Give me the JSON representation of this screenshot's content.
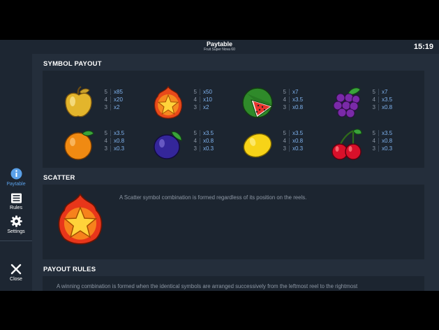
{
  "header": {
    "title": "Paytable",
    "subtitle": "Fruit Super Nova 60",
    "clock": "15:19"
  },
  "sidebar": {
    "items": [
      {
        "label": "Paytable",
        "icon": "info-icon",
        "active": true
      },
      {
        "label": "Rules",
        "icon": "rules-list-icon",
        "active": false
      },
      {
        "label": "Settings",
        "icon": "gear-icon",
        "active": false
      }
    ],
    "close_label": "Close"
  },
  "symbol_payout": {
    "title": "SYMBOL PAYOUT",
    "symbols": [
      {
        "name": "golden-apple",
        "icon": "golden-apple-icon",
        "pays": [
          {
            "count": "5",
            "value": "x85"
          },
          {
            "count": "4",
            "value": "x20"
          },
          {
            "count": "3",
            "value": "x2"
          }
        ]
      },
      {
        "name": "star",
        "icon": "star-icon",
        "pays": [
          {
            "count": "5",
            "value": "x50"
          },
          {
            "count": "4",
            "value": "x10"
          },
          {
            "count": "3",
            "value": "x2"
          }
        ]
      },
      {
        "name": "watermelon",
        "icon": "watermelon-icon",
        "pays": [
          {
            "count": "5",
            "value": "x7"
          },
          {
            "count": "4",
            "value": "x3.5"
          },
          {
            "count": "3",
            "value": "x0.8"
          }
        ]
      },
      {
        "name": "grapes",
        "icon": "grapes-icon",
        "pays": [
          {
            "count": "5",
            "value": "x7"
          },
          {
            "count": "4",
            "value": "x3.5"
          },
          {
            "count": "3",
            "value": "x0.8"
          }
        ]
      },
      {
        "name": "orange",
        "icon": "orange-icon",
        "pays": [
          {
            "count": "5",
            "value": "x3.5"
          },
          {
            "count": "4",
            "value": "x0.8"
          },
          {
            "count": "3",
            "value": "x0.3"
          }
        ]
      },
      {
        "name": "plum",
        "icon": "plum-icon",
        "pays": [
          {
            "count": "5",
            "value": "x3.5"
          },
          {
            "count": "4",
            "value": "x0.8"
          },
          {
            "count": "3",
            "value": "x0.3"
          }
        ]
      },
      {
        "name": "lemon",
        "icon": "lemon-icon",
        "pays": [
          {
            "count": "5",
            "value": "x3.5"
          },
          {
            "count": "4",
            "value": "x0.8"
          },
          {
            "count": "3",
            "value": "x0.3"
          }
        ]
      },
      {
        "name": "cherries",
        "icon": "cherries-icon",
        "pays": [
          {
            "count": "5",
            "value": "x3.5"
          },
          {
            "count": "4",
            "value": "x0.8"
          },
          {
            "count": "3",
            "value": "x0.3"
          }
        ]
      }
    ]
  },
  "scatter": {
    "title": "SCATTER",
    "icon": "scatter-star-icon",
    "text": "A Scatter symbol combination is formed regardless of its position on the reels."
  },
  "payout_rules": {
    "title": "PAYOUT RULES",
    "text": "A winning combination is formed when the identical symbols are arranged successively from the leftmost reel to the rightmost"
  },
  "colors": {
    "accent": "#5aa0e8",
    "payout_value": "#7fb2ee",
    "panel": "#1c2530",
    "background": "#242e3b"
  }
}
